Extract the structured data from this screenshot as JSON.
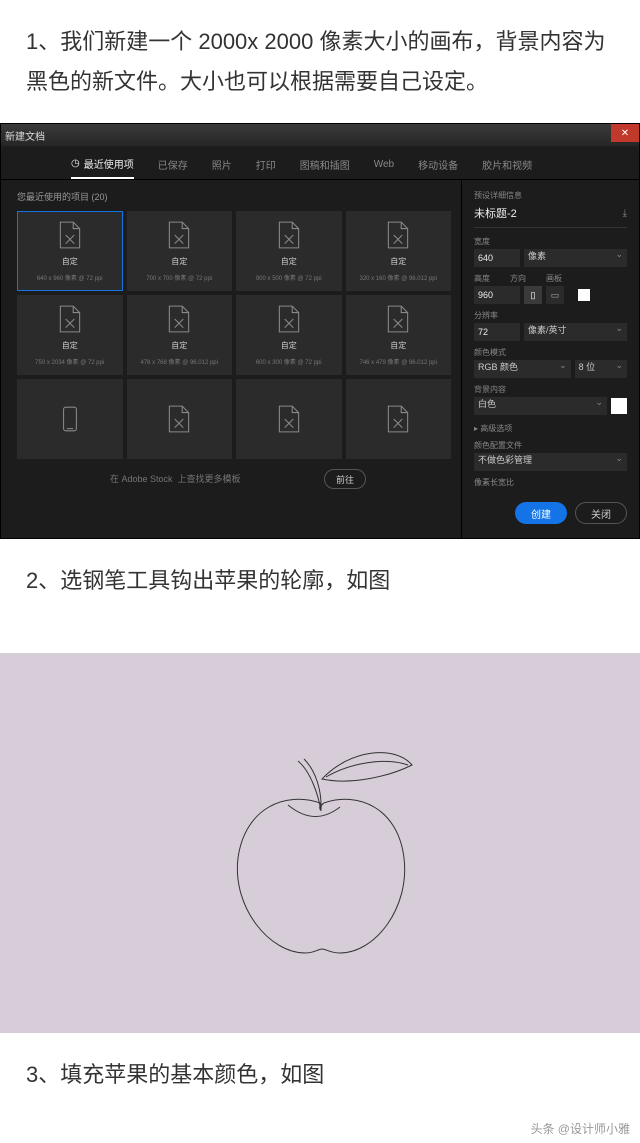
{
  "article": {
    "step1": "1、我们新建一个 2000x 2000 像素大小的画布，背景内容为黑色的新文件。大小也可以根据需要自己设定。",
    "step2": "2、选钢笔工具钩出苹果的轮廓，如图",
    "step3": "3、填充苹果的基本颜色，如图",
    "credit": "头条 @设计师小雅"
  },
  "dialog": {
    "title": "新建文档",
    "tabs": {
      "recent": "最近使用项",
      "saved": "已保存",
      "photo": "照片",
      "print": "打印",
      "art": "图稿和插图",
      "web": "Web",
      "mobile": "移动设备",
      "film": "胶片和视频"
    },
    "presets_head": "您最近使用的项目 (20)",
    "preset_label": "自定",
    "preset_dims": [
      "640 x 960 像素 @ 72 ppi",
      "700 x 700 像素 @ 72 ppi",
      "900 x 500 像素 @ 72 ppi",
      "320 x 160 像素 @ 96.012 ppi",
      "750 x 2034 像素 @ 72 ppi",
      "478 x 768 像素 @ 96.012 ppi",
      "600 x 300 像素 @ 72 ppi",
      "746 x 479 像素 @ 96.012 ppi"
    ],
    "search_placeholder": "在 Adobe Stock  上查找更多模板",
    "go_btn": "前往",
    "create_btn": "创建",
    "close_btn": "关闭"
  },
  "settings": {
    "section": "预设详细信息",
    "doc_name": "未标题-2",
    "width_label": "宽度",
    "width_value": "640",
    "width_unit": "像素",
    "height_label": "高度",
    "orient_label": "方向",
    "artboard_label": "画板",
    "height_value": "960",
    "res_label": "分辨率",
    "res_value": "72",
    "res_unit": "像素/英寸",
    "color_label": "颜色模式",
    "color_value": "RGB 颜色",
    "bit_value": "8 位",
    "bg_label": "背景内容",
    "bg_value": "白色",
    "adv_toggle": "▸ 高级选项",
    "profile_label": "颜色配置文件",
    "profile_value": "不做色彩管理",
    "aspect_label": "像素长宽比"
  }
}
